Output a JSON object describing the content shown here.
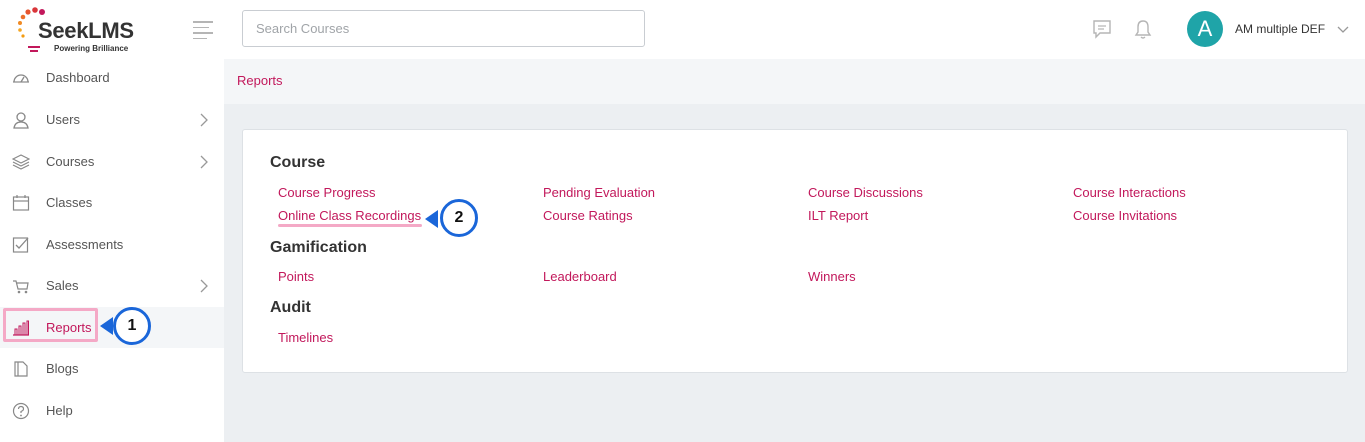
{
  "brand": {
    "name": "SeekLMS",
    "tagline": "Powering Brilliance"
  },
  "header": {
    "search_placeholder": "Search Courses",
    "avatar_initial": "A",
    "user_name": "AM multiple DEF"
  },
  "sidebar": {
    "items": [
      {
        "label": "Dashboard",
        "icon": "dashboard-icon",
        "chevron": false
      },
      {
        "label": "Users",
        "icon": "users-icon",
        "chevron": true
      },
      {
        "label": "Courses",
        "icon": "courses-icon",
        "chevron": true
      },
      {
        "label": "Classes",
        "icon": "calendar-icon",
        "chevron": false
      },
      {
        "label": "Assessments",
        "icon": "assessment-icon",
        "chevron": false
      },
      {
        "label": "Sales",
        "icon": "cart-icon",
        "chevron": true
      },
      {
        "label": "Reports",
        "icon": "reports-icon",
        "chevron": false,
        "active": true
      },
      {
        "label": "Blogs",
        "icon": "blogs-icon",
        "chevron": false
      },
      {
        "label": "Help",
        "icon": "help-icon",
        "chevron": false
      }
    ]
  },
  "breadcrumb": "Reports",
  "reports": {
    "course": {
      "title": "Course",
      "links": [
        "Course Progress",
        "Pending Evaluation",
        "Course Discussions",
        "Course Interactions",
        "Online Class Recordings",
        "Course Ratings",
        "ILT Report",
        "Course Invitations"
      ]
    },
    "gamification": {
      "title": "Gamification",
      "links": [
        "Points",
        "Leaderboard",
        "Winners"
      ]
    },
    "audit": {
      "title": "Audit",
      "links": [
        "Timelines"
      ]
    }
  },
  "callouts": {
    "first": "1",
    "second": "2"
  },
  "colors": {
    "accent": "#c2185b",
    "callout": "#1a66d9",
    "highlight": "#f4a9c6",
    "avatar": "#1fa4a8"
  }
}
